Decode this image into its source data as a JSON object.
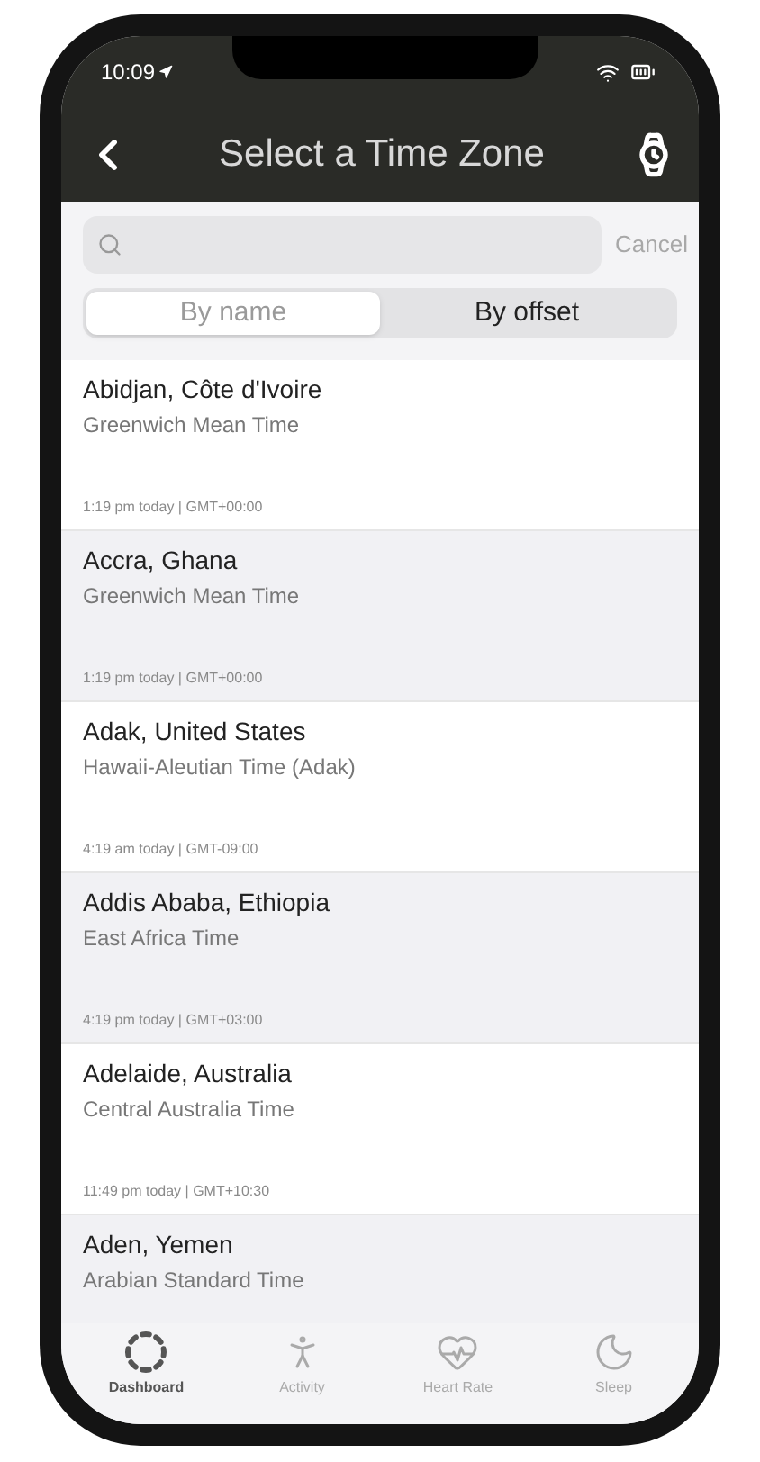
{
  "status_bar": {
    "time": "10:09"
  },
  "header": {
    "title": "Select a Time Zone"
  },
  "search": {
    "cancel": "Cancel"
  },
  "segments": [
    {
      "label": "By name",
      "selected": true
    },
    {
      "label": "By offset",
      "selected": false
    }
  ],
  "zones": [
    {
      "city": "Abidjan, Côte d'Ivoire",
      "zone": "Greenwich Mean Time",
      "time": "1:19 pm today | GMT+00:00"
    },
    {
      "city": "Accra, Ghana",
      "zone": "Greenwich Mean Time",
      "time": "1:19 pm today | GMT+00:00"
    },
    {
      "city": "Adak, United States",
      "zone": "Hawaii-Aleutian Time (Adak)",
      "time": "4:19 am today | GMT-09:00"
    },
    {
      "city": "Addis Ababa, Ethiopia",
      "zone": "East Africa Time",
      "time": "4:19 pm today | GMT+03:00"
    },
    {
      "city": "Adelaide, Australia",
      "zone": "Central Australia Time",
      "time": "11:49 pm today | GMT+10:30"
    },
    {
      "city": "Aden, Yemen",
      "zone": "Arabian Standard Time"
    }
  ],
  "tab_bar": [
    {
      "kind": "dashboard",
      "label": "Dashboard",
      "selected": true
    },
    {
      "kind": "activity",
      "label": "Activity",
      "selected": false
    },
    {
      "kind": "heart",
      "label": "Heart Rate",
      "selected": false
    },
    {
      "kind": "sleep",
      "label": "Sleep",
      "selected": false
    }
  ]
}
